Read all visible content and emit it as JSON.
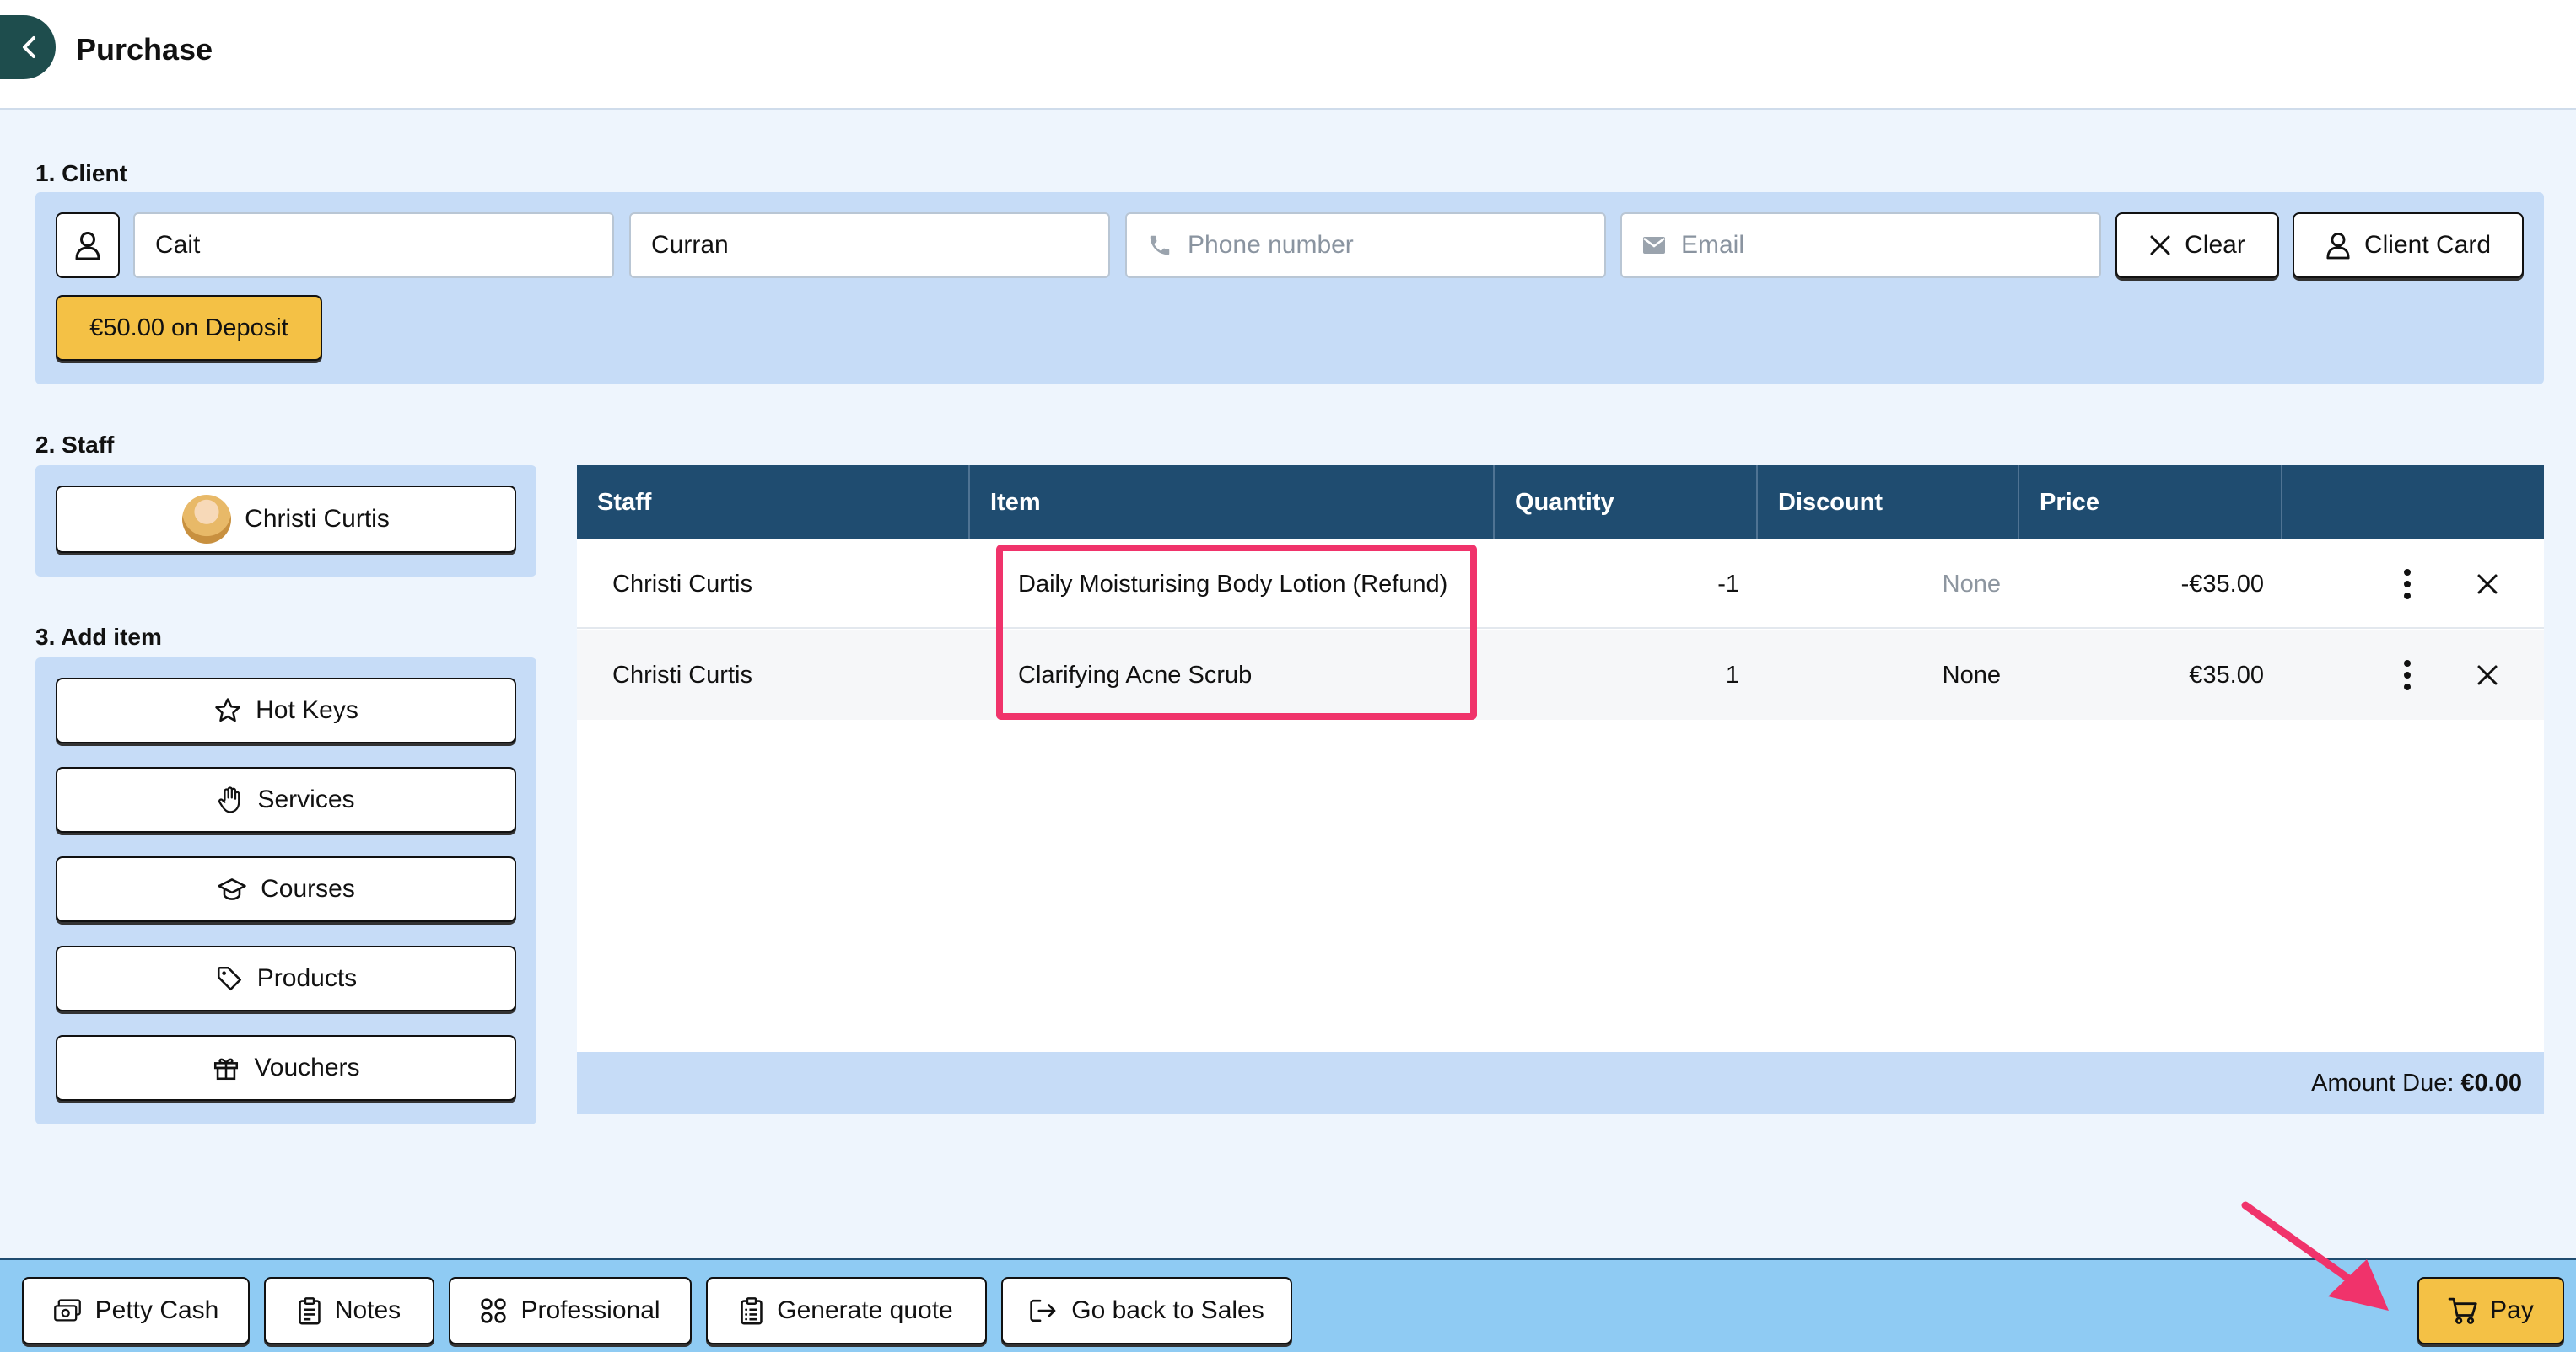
{
  "header": {
    "title": "Purchase"
  },
  "client": {
    "section_label": "1. Client",
    "first_name": "Cait",
    "last_name": "Curran",
    "phone_placeholder": "Phone number",
    "email_placeholder": "Email",
    "clear_label": "Clear",
    "client_card_label": "Client Card",
    "deposit_label": "€50.00 on Deposit"
  },
  "staff": {
    "section_label": "2. Staff",
    "selected_name": "Christi Curtis"
  },
  "add_item": {
    "section_label": "3. Add item",
    "buttons": [
      "Hot Keys",
      "Services",
      "Courses",
      "Products",
      "Vouchers"
    ]
  },
  "table": {
    "columns": [
      "Staff",
      "Item",
      "Quantity",
      "Discount",
      "Price"
    ],
    "rows": [
      {
        "staff": "Christi Curtis",
        "item": "Daily Moisturising Body Lotion (Refund)",
        "quantity": "-1",
        "discount": "None",
        "price": "-€35.00"
      },
      {
        "staff": "Christi Curtis",
        "item": "Clarifying Acne Scrub",
        "quantity": "1",
        "discount": "None",
        "price": "€35.00"
      }
    ],
    "amount_due_label": "Amount Due:",
    "amount_due_value": "€0.00"
  },
  "footer": {
    "buttons": [
      "Petty Cash",
      "Notes",
      "Professional",
      "Generate quote",
      "Go back to Sales"
    ],
    "pay_label": "Pay"
  },
  "colors": {
    "header_bg": "#ffffff",
    "panel_bg": "#c6dcf7",
    "table_header_bg": "#1f4c70",
    "accent_yellow": "#f4c145",
    "highlight_pink": "#f0336b",
    "footer_bg": "#8fcbf3",
    "back_button_bg": "#1e4d4d"
  },
  "icons": {
    "back": "chevron-left-icon",
    "client_avatar": "user-icon",
    "phone": "phone-icon",
    "email": "envelope-icon",
    "clear": "close-icon",
    "client_card": "user-icon",
    "hot_keys": "star-icon",
    "services": "hand-icon",
    "courses": "graduation-cap-icon",
    "products": "tag-icon",
    "vouchers": "gift-icon",
    "row_menu": "more-vertical-icon",
    "row_remove": "close-icon",
    "petty_cash": "cash-icon",
    "notes": "clipboard-icon",
    "professional": "grid-icon",
    "generate_quote": "clipboard-list-icon",
    "go_back": "logout-icon",
    "pay": "cart-icon"
  }
}
